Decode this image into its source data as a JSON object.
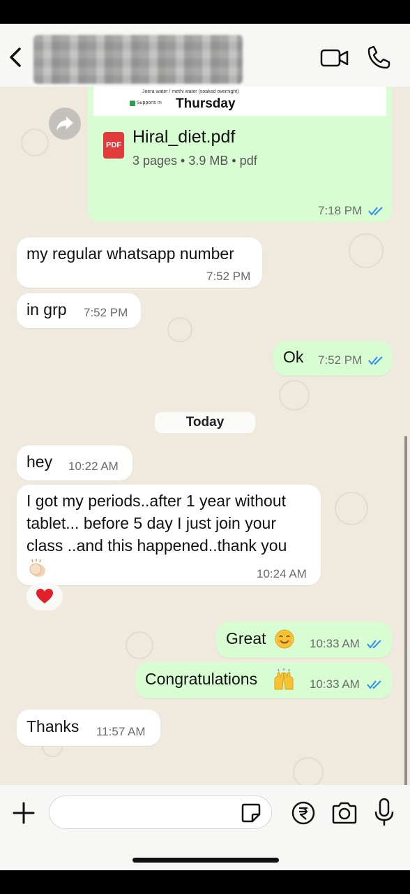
{
  "header": {
    "contact_name_hidden": true,
    "icons": [
      "back-arrow-icon",
      "video-call-icon",
      "phone-call-icon"
    ]
  },
  "document": {
    "preview_line1": "Jeera water / methi water (soaked overnight)",
    "preview_line2": "Supports m",
    "day_label": "Thursday",
    "file_name": "Hiral_diet.pdf",
    "file_meta": "3 pages • 3.9 MB • pdf",
    "time": "7:18 PM",
    "pdf_badge": "PDF"
  },
  "messages": [
    {
      "id": "m1",
      "dir": "in",
      "text": "my regular whatsapp number",
      "time": "7:52 PM"
    },
    {
      "id": "m2",
      "dir": "in",
      "text": "in grp",
      "time": "7:52 PM"
    },
    {
      "id": "m3",
      "dir": "out",
      "text": "Ok",
      "time": "7:52 PM"
    },
    {
      "id": "m4",
      "dir": "in",
      "text": "hey",
      "time": "10:22 AM"
    },
    {
      "id": "m5",
      "dir": "in",
      "lines": [
        "I got my periods..after 1 year without",
        "tablet... before 5 day I just join your",
        "class ..and this happened..thank you"
      ],
      "time": "10:24 AM"
    },
    {
      "id": "m6",
      "dir": "out",
      "text": "Great",
      "time": "10:33 AM"
    },
    {
      "id": "m7",
      "dir": "out",
      "text": "Congratulations",
      "time": "10:33 AM"
    },
    {
      "id": "m8",
      "dir": "in",
      "text": "Thanks",
      "time": "11:57 AM"
    }
  ],
  "date_separator": "Today",
  "reaction": "heart",
  "input_bar": {
    "placeholder": "",
    "icons": [
      "plus-icon",
      "sticker-icon",
      "rupee-icon",
      "camera-icon",
      "microphone-icon"
    ]
  },
  "colors": {
    "outgoing_bubble": "#d9fdd3",
    "incoming_bubble": "#ffffff",
    "wallpaper": "#efe9de",
    "read_ticks": "#2f8ef2"
  }
}
